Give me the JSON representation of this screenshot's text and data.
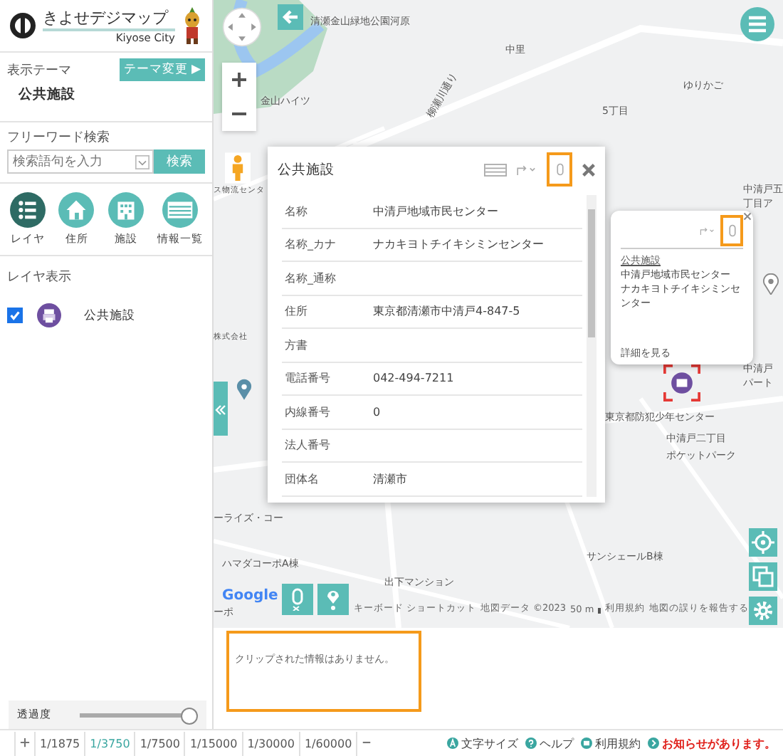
{
  "header": {
    "title": "きよせデジマップ",
    "subtitle": "Kiyose City"
  },
  "theme": {
    "label": "表示テーマ",
    "button": "テーマ変更 ▶",
    "value": "公共施設"
  },
  "search": {
    "label": "フリーワード検索",
    "placeholder": "検索語句を入力",
    "button": "検索"
  },
  "tools": [
    {
      "kind": "layer",
      "label": "レイヤ",
      "selected": true
    },
    {
      "kind": "address",
      "label": "住所",
      "selected": false
    },
    {
      "kind": "facility",
      "label": "施設",
      "selected": false
    },
    {
      "kind": "list",
      "label": "情報一覧",
      "selected": false
    }
  ],
  "layers": {
    "title": "レイヤ表示",
    "items": [
      {
        "label": "公共施設",
        "checked": true
      }
    ]
  },
  "opacity": {
    "label": "透過度",
    "level": 1
  },
  "map_labels": [
    "清瀬金山緑地公園河原",
    "中里",
    "柳瀬川通り",
    "金山ハイツ",
    "5丁目",
    "ゆりかご",
    "ス物流センタ",
    "株式会社",
    "中清戸五",
    "丁目ア",
    "中清戸",
    "パート",
    "東京都防犯少年センター",
    "中清戸二丁目",
    "ポケットパーク",
    "ーライズ・コー",
    "ハマダコーポA棟",
    "出下マンション",
    "サンシェールB棟",
    "ーポ"
  ],
  "attribution": {
    "logo": "Google",
    "shortcuts": "キーボード ショートカット",
    "data": "地図データ ©2023",
    "scale": "50 m",
    "terms": "利用規約",
    "report": "地図の誤りを報告する"
  },
  "popup": {
    "title": "公共施設",
    "rows": [
      {
        "name": "名称",
        "value": "中清戸地域市民センター"
      },
      {
        "name": "名称_カナ",
        "value": "ナカキヨトチイキシミンセンター"
      },
      {
        "name": "名称_通称",
        "value": ""
      },
      {
        "name": "住所",
        "value": "東京都清瀬市中清戸4-847-5"
      },
      {
        "name": "方書",
        "value": ""
      },
      {
        "name": "電話番号",
        "value": "042-494-7211"
      },
      {
        "name": "内線番号",
        "value": "0"
      },
      {
        "name": "法人番号",
        "value": ""
      },
      {
        "name": "団体名",
        "value": "清瀬市"
      }
    ]
  },
  "mini_popup": {
    "category": "公共施設",
    "name": "中清戸地域市民センター",
    "kana": "ナカキヨトチイキシミンセンター",
    "link": "詳細を見る"
  },
  "clip": {
    "message": "クリップされた情報はありません。"
  },
  "scales": [
    {
      "label": "1/1875",
      "selected": false
    },
    {
      "label": "1/3750",
      "selected": true
    },
    {
      "label": "1/7500",
      "selected": false
    },
    {
      "label": "1/15000",
      "selected": false
    },
    {
      "label": "1/30000",
      "selected": false
    },
    {
      "label": "1/60000",
      "selected": false
    }
  ],
  "footer_links": [
    {
      "kind": "font",
      "label": "文字サイズ"
    },
    {
      "kind": "help",
      "label": "ヘルプ"
    },
    {
      "kind": "terms",
      "label": "利用規約"
    },
    {
      "kind": "notice",
      "label": "お知らせがあります。"
    }
  ]
}
